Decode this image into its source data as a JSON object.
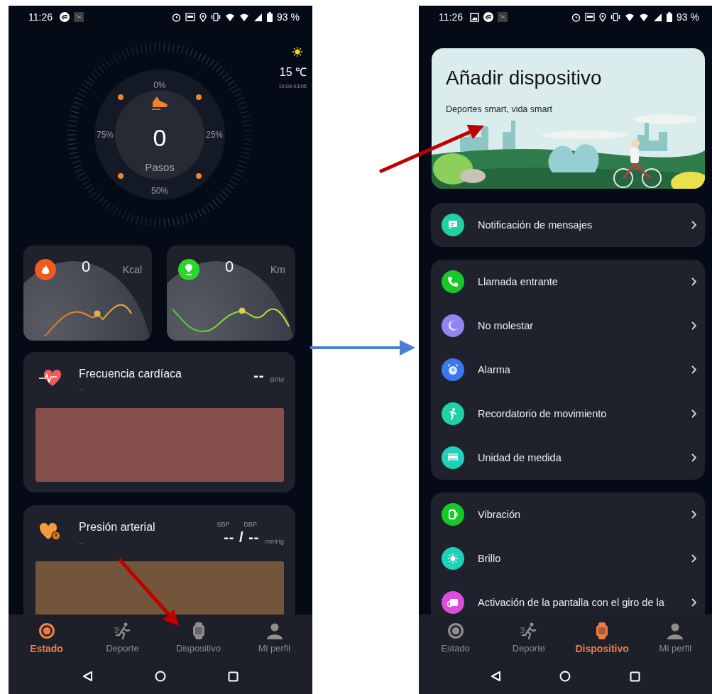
{
  "status_screen": {
    "status_bar": {
      "time": "11:26",
      "battery": "93 %"
    },
    "weather": {
      "temperature": "15 ℃",
      "updated": "10:08 03/05"
    },
    "steps": {
      "value": "0",
      "label": "Pasos",
      "marks": [
        "0%",
        "25%",
        "50%",
        "75%"
      ]
    },
    "summary_cards": [
      {
        "value": "0",
        "unit": "Kcal",
        "color": "#f05a1e"
      },
      {
        "value": "0",
        "unit": "Km",
        "color": "#2bd62b"
      }
    ],
    "health_cards": [
      {
        "kind": "single",
        "title": "Frecuencia cardíaca",
        "subtitle": "--",
        "value": "--",
        "unit": "BPM",
        "color": "#844f4a"
      },
      {
        "kind": "pair",
        "title": "Presión arterial",
        "subtitle": "--",
        "labels": [
          "SBP",
          "DBP"
        ],
        "value": "-- / --",
        "unit": "mmHg",
        "color": "#73553b"
      }
    ],
    "tab_bar": [
      {
        "label": "Estado",
        "selected": true
      },
      {
        "label": "Deporte",
        "selected": false
      },
      {
        "label": "Dispositivo",
        "selected": false
      },
      {
        "label": "Mi perfil",
        "selected": false
      }
    ]
  },
  "device_screen": {
    "status_bar": {
      "time": "11:26",
      "battery": "93 %"
    },
    "banner": {
      "title": "Añadir dispositivo",
      "subtitle": "Deportes smart, vida smart"
    },
    "setting_groups": [
      {
        "items": [
          {
            "label": "Notificación de mensajes",
            "color": "#1fd1a5"
          }
        ]
      },
      {
        "items": [
          {
            "label": "Llamada entrante",
            "color": "#16c928"
          },
          {
            "label": "No molestar",
            "color": "#8f86f0"
          },
          {
            "label": "Alarma",
            "color": "#3a78f0"
          },
          {
            "label": "Recordatorio de movimiento",
            "color": "#1fd1a5"
          },
          {
            "label": "Unidad de medida",
            "color": "#1fd1b8"
          }
        ]
      },
      {
        "items": [
          {
            "label": "Vibración",
            "color": "#16c928"
          },
          {
            "label": "Brillo",
            "color": "#1fd1b8"
          },
          {
            "label": "Activación de la pantalla con el giro de la",
            "color": "#d94fd9"
          }
        ]
      }
    ],
    "tab_bar": [
      {
        "label": "Estado",
        "selected": false
      },
      {
        "label": "Deporte",
        "selected": false
      },
      {
        "label": "Dispositivo",
        "selected": true
      },
      {
        "label": "Mi perfil",
        "selected": false
      }
    ]
  },
  "annotations": [
    {
      "kind": "arrow",
      "color": "#c00000"
    },
    {
      "kind": "arrow",
      "color": "#4a7fd4"
    },
    {
      "kind": "arrow",
      "color": "#c00000"
    }
  ]
}
